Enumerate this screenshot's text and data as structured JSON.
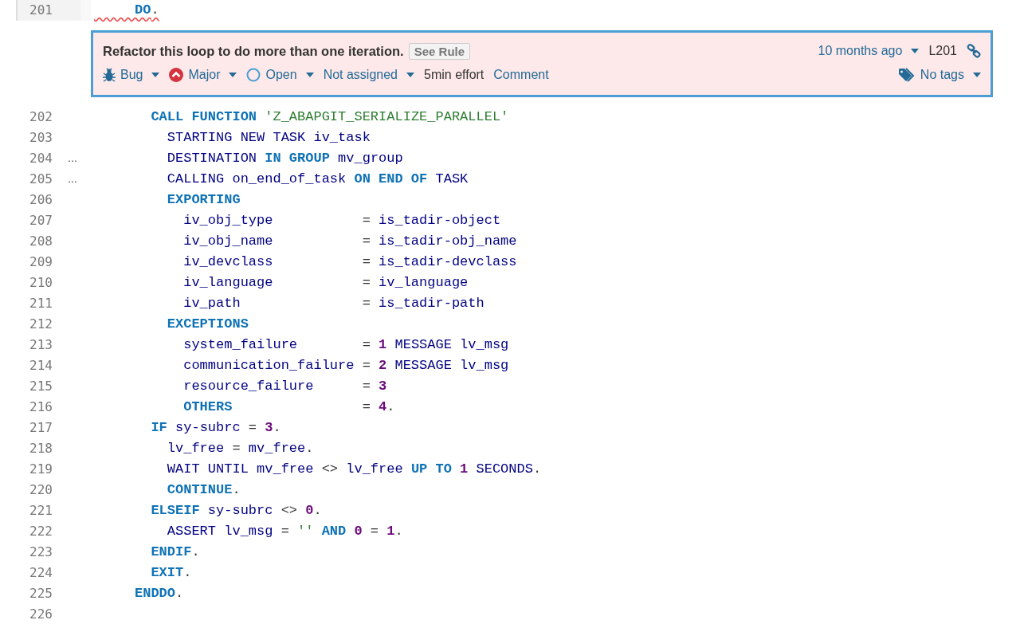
{
  "lines": [
    {
      "number": "201",
      "flagged": true,
      "tokens": [
        {
          "kind": "keyword",
          "text": "     DO"
        },
        {
          "kind": "punct",
          "text": "."
        }
      ],
      "issue": {
        "message": "Refactor this loop to do more than one iteration.",
        "rule_button": "See Rule",
        "date": "10 months ago",
        "line": "L201",
        "actions": [
          {
            "kind": "type",
            "label": "Bug",
            "dropdown": true
          },
          {
            "kind": "severity",
            "label": "Major",
            "dropdown": true
          },
          {
            "kind": "status",
            "label": "Open",
            "dropdown": true
          },
          {
            "kind": "assignee",
            "label": "Not assigned",
            "dropdown": true
          },
          {
            "kind": "effort",
            "label": "5min effort",
            "dropdown": false
          },
          {
            "kind": "comment",
            "label": "Comment",
            "dropdown": false
          }
        ],
        "tags": "No tags"
      }
    },
    {
      "number": "202",
      "flagged": false,
      "tokens": [
        {
          "kind": "keyword",
          "text": "       CALL FUNCTION"
        },
        {
          "kind": "string",
          "text": " 'Z_ABAPGIT_SERIALIZE_PARALLEL'"
        }
      ]
    },
    {
      "number": "203",
      "flagged": false,
      "tokens": [
        {
          "kind": "ident",
          "text": "         STARTING NEW TASK iv_task"
        }
      ]
    },
    {
      "number": "204",
      "marker": "…",
      "flagged": false,
      "tokens": [
        {
          "kind": "ident",
          "text": "         DESTINATION "
        },
        {
          "kind": "keyword",
          "text": "IN GROUP"
        },
        {
          "kind": "ident",
          "text": " mv_group"
        }
      ]
    },
    {
      "number": "205",
      "marker": "…",
      "flagged": false,
      "tokens": [
        {
          "kind": "ident",
          "text": "         CALLING on_end_of_task "
        },
        {
          "kind": "keyword",
          "text": "ON END OF"
        },
        {
          "kind": "ident",
          "text": " TASK"
        }
      ]
    },
    {
      "number": "206",
      "flagged": false,
      "tokens": [
        {
          "kind": "keyword",
          "text": "         EXPORTING"
        }
      ]
    },
    {
      "number": "207",
      "flagged": false,
      "tokens": [
        {
          "kind": "ident",
          "text": "           iv_obj_type"
        },
        {
          "kind": "punct",
          "text": "           = "
        },
        {
          "kind": "ident",
          "text": "is_tadir-object"
        }
      ]
    },
    {
      "number": "208",
      "flagged": false,
      "tokens": [
        {
          "kind": "ident",
          "text": "           iv_obj_name"
        },
        {
          "kind": "punct",
          "text": "           = "
        },
        {
          "kind": "ident",
          "text": "is_tadir-obj_name"
        }
      ]
    },
    {
      "number": "209",
      "flagged": false,
      "tokens": [
        {
          "kind": "ident",
          "text": "           iv_devclass"
        },
        {
          "kind": "punct",
          "text": "           = "
        },
        {
          "kind": "ident",
          "text": "is_tadir-devclass"
        }
      ]
    },
    {
      "number": "210",
      "flagged": false,
      "tokens": [
        {
          "kind": "ident",
          "text": "           iv_language"
        },
        {
          "kind": "punct",
          "text": "           = "
        },
        {
          "kind": "ident",
          "text": "iv_language"
        }
      ]
    },
    {
      "number": "211",
      "flagged": false,
      "tokens": [
        {
          "kind": "ident",
          "text": "           iv_path"
        },
        {
          "kind": "punct",
          "text": "               = "
        },
        {
          "kind": "ident",
          "text": "is_tadir-path"
        }
      ]
    },
    {
      "number": "212",
      "flagged": false,
      "tokens": [
        {
          "kind": "keyword",
          "text": "         EXCEPTIONS"
        }
      ]
    },
    {
      "number": "213",
      "flagged": false,
      "tokens": [
        {
          "kind": "ident",
          "text": "           system_failure"
        },
        {
          "kind": "punct",
          "text": "        = "
        },
        {
          "kind": "number",
          "text": "1"
        },
        {
          "kind": "ident",
          "text": " MESSAGE lv_msg"
        }
      ]
    },
    {
      "number": "214",
      "flagged": false,
      "tokens": [
        {
          "kind": "ident",
          "text": "           communication_failure"
        },
        {
          "kind": "punct",
          "text": " = "
        },
        {
          "kind": "number",
          "text": "2"
        },
        {
          "kind": "ident",
          "text": " MESSAGE lv_msg"
        }
      ]
    },
    {
      "number": "215",
      "flagged": false,
      "tokens": [
        {
          "kind": "ident",
          "text": "           resource_failure"
        },
        {
          "kind": "punct",
          "text": "      = "
        },
        {
          "kind": "number",
          "text": "3"
        }
      ]
    },
    {
      "number": "216",
      "flagged": false,
      "tokens": [
        {
          "kind": "keyword",
          "text": "           OTHERS"
        },
        {
          "kind": "punct",
          "text": "                = "
        },
        {
          "kind": "number",
          "text": "4"
        },
        {
          "kind": "punct",
          "text": "."
        }
      ]
    },
    {
      "number": "217",
      "flagged": false,
      "tokens": [
        {
          "kind": "keyword",
          "text": "       IF"
        },
        {
          "kind": "ident",
          "text": " sy-subrc "
        },
        {
          "kind": "punct",
          "text": "= "
        },
        {
          "kind": "number",
          "text": "3"
        },
        {
          "kind": "punct",
          "text": "."
        }
      ]
    },
    {
      "number": "218",
      "flagged": false,
      "tokens": [
        {
          "kind": "ident",
          "text": "         lv_free "
        },
        {
          "kind": "punct",
          "text": "= "
        },
        {
          "kind": "ident",
          "text": "mv_free"
        },
        {
          "kind": "punct",
          "text": "."
        }
      ]
    },
    {
      "number": "219",
      "flagged": false,
      "tokens": [
        {
          "kind": "ident",
          "text": "         WAIT UNTIL mv_free "
        },
        {
          "kind": "punct",
          "text": "<> "
        },
        {
          "kind": "ident",
          "text": "lv_free "
        },
        {
          "kind": "keyword",
          "text": "UP TO "
        },
        {
          "kind": "number",
          "text": "1"
        },
        {
          "kind": "ident",
          "text": " SECONDS"
        },
        {
          "kind": "punct",
          "text": "."
        }
      ]
    },
    {
      "number": "220",
      "flagged": false,
      "tokens": [
        {
          "kind": "keyword",
          "text": "         CONTINUE"
        },
        {
          "kind": "punct",
          "text": "."
        }
      ]
    },
    {
      "number": "221",
      "flagged": false,
      "tokens": [
        {
          "kind": "keyword",
          "text": "       ELSEIF"
        },
        {
          "kind": "ident",
          "text": " sy-subrc "
        },
        {
          "kind": "punct",
          "text": "<> "
        },
        {
          "kind": "number",
          "text": "0"
        },
        {
          "kind": "punct",
          "text": "."
        }
      ]
    },
    {
      "number": "222",
      "flagged": false,
      "tokens": [
        {
          "kind": "ident",
          "text": "         ASSERT lv_msg "
        },
        {
          "kind": "punct",
          "text": "= "
        },
        {
          "kind": "string",
          "text": "'' "
        },
        {
          "kind": "keyword",
          "text": "AND "
        },
        {
          "kind": "number",
          "text": "0"
        },
        {
          "kind": "punct",
          "text": " = "
        },
        {
          "kind": "number",
          "text": "1"
        },
        {
          "kind": "punct",
          "text": "."
        }
      ]
    },
    {
      "number": "223",
      "flagged": false,
      "tokens": [
        {
          "kind": "keyword",
          "text": "       ENDIF"
        },
        {
          "kind": "punct",
          "text": "."
        }
      ]
    },
    {
      "number": "224",
      "flagged": false,
      "tokens": [
        {
          "kind": "keyword",
          "text": "       EXIT"
        },
        {
          "kind": "punct",
          "text": "."
        }
      ]
    },
    {
      "number": "225",
      "flagged": false,
      "tokens": [
        {
          "kind": "keyword",
          "text": "     ENDDO"
        },
        {
          "kind": "punct",
          "text": "."
        }
      ]
    },
    {
      "number": "226"
    }
  ]
}
